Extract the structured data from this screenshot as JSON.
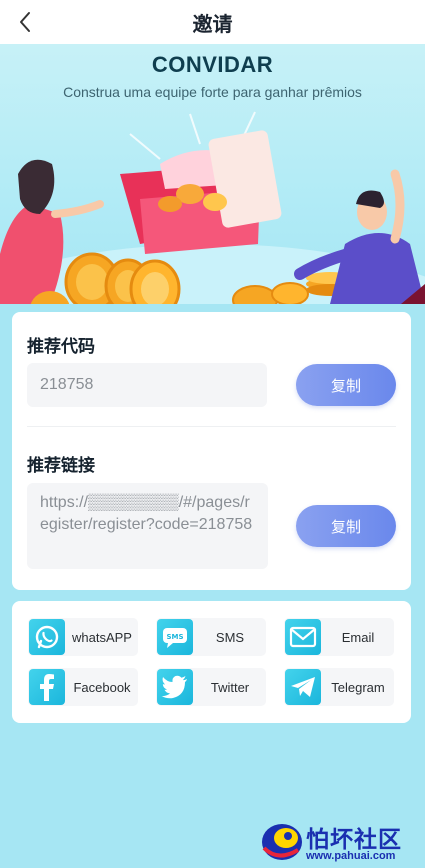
{
  "header": {
    "title": "邀请",
    "back_icon": "chevron-left-icon"
  },
  "hero": {
    "title": "CONVIDAR",
    "subtitle": "Construa uma equipe forte para ganhar prêmios"
  },
  "referral": {
    "code_label": "推荐代码",
    "code_value": "218758",
    "link_label": "推荐链接",
    "link_value": "https://▒▒▒▒▒▒▒▒/#/pages/register/register?code=218758",
    "copy_label": "复制"
  },
  "share": {
    "items": [
      {
        "label": "whatsAPP",
        "icon": "whatsapp-icon"
      },
      {
        "label": "SMS",
        "icon": "sms-icon"
      },
      {
        "label": "Email",
        "icon": "email-icon"
      },
      {
        "label": "Facebook",
        "icon": "facebook-icon"
      },
      {
        "label": "Twitter",
        "icon": "twitter-icon"
      },
      {
        "label": "Telegram",
        "icon": "telegram-icon"
      }
    ]
  },
  "watermark": {
    "name": "怕坏社区",
    "url": "www.pahuai.com"
  },
  "colors": {
    "background": "#a6e6f3",
    "accent_button": "#6a88ec",
    "share_icon": "#1bb6dc",
    "title_text": "#0f3e4f"
  }
}
